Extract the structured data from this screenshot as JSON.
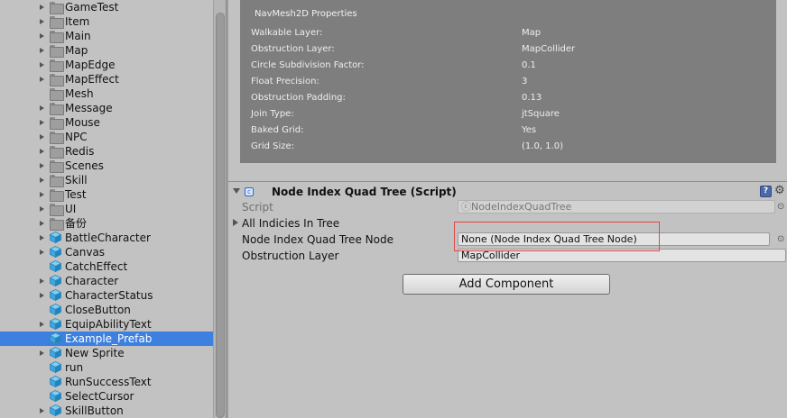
{
  "tree": {
    "items": [
      {
        "label": "GameTest",
        "icon": "folder-icon",
        "arrow": true
      },
      {
        "label": "Item",
        "icon": "folder-icon",
        "arrow": true
      },
      {
        "label": "Main",
        "icon": "folder-icon",
        "arrow": true
      },
      {
        "label": "Map",
        "icon": "folder-icon",
        "arrow": true
      },
      {
        "label": "MapEdge",
        "icon": "folder-icon",
        "arrow": true
      },
      {
        "label": "MapEffect",
        "icon": "folder-icon",
        "arrow": true
      },
      {
        "label": "Mesh",
        "icon": "folder-icon",
        "arrow": false
      },
      {
        "label": "Message",
        "icon": "folder-icon",
        "arrow": true
      },
      {
        "label": "Mouse",
        "icon": "folder-icon",
        "arrow": true
      },
      {
        "label": "NPC",
        "icon": "folder-icon",
        "arrow": true
      },
      {
        "label": "Redis",
        "icon": "folder-icon",
        "arrow": true
      },
      {
        "label": "Scenes",
        "icon": "folder-icon",
        "arrow": true
      },
      {
        "label": "Skill",
        "icon": "folder-icon",
        "arrow": true
      },
      {
        "label": "Test",
        "icon": "folder-icon",
        "arrow": true
      },
      {
        "label": "UI",
        "icon": "folder-icon",
        "arrow": true
      },
      {
        "label": "备份",
        "icon": "folder-icon",
        "arrow": true
      },
      {
        "label": "BattleCharacter",
        "icon": "prefab-icon",
        "arrow": true
      },
      {
        "label": "Canvas",
        "icon": "prefab-icon",
        "arrow": true
      },
      {
        "label": "CatchEffect",
        "icon": "prefab-icon",
        "arrow": false
      },
      {
        "label": "Character",
        "icon": "prefab-icon",
        "arrow": true
      },
      {
        "label": "CharacterStatus",
        "icon": "prefab-icon",
        "arrow": true
      },
      {
        "label": "CloseButton",
        "icon": "prefab-icon",
        "arrow": false
      },
      {
        "label": "EquipAbilityText",
        "icon": "prefab-icon",
        "arrow": true
      },
      {
        "label": "Example_Prefab",
        "icon": "prefab-icon",
        "arrow": false,
        "selected": true
      },
      {
        "label": "New Sprite",
        "icon": "prefab-icon",
        "arrow": true
      },
      {
        "label": "run",
        "icon": "prefab-icon",
        "arrow": false
      },
      {
        "label": "RunSuccessText",
        "icon": "prefab-icon",
        "arrow": false
      },
      {
        "label": "SelectCursor",
        "icon": "prefab-icon",
        "arrow": false
      },
      {
        "label": "SkillButton",
        "icon": "prefab-icon",
        "arrow": true
      }
    ]
  },
  "navmesh": {
    "title": "NavMesh2D Properties",
    "props": [
      {
        "key": "Walkable Layer:",
        "value": "Map"
      },
      {
        "key": "Obstruction Layer:",
        "value": "MapCollider"
      },
      {
        "key": "Circle Subdivision Factor:",
        "value": "0.1"
      },
      {
        "key": "Float Precision:",
        "value": "3"
      },
      {
        "key": "Obstruction Padding:",
        "value": "0.13"
      },
      {
        "key": "Join Type:",
        "value": "jtSquare"
      },
      {
        "key": "Baked Grid:",
        "value": "Yes"
      },
      {
        "key": "Grid Size:",
        "value": "(1.0, 1.0)"
      }
    ]
  },
  "component": {
    "title": "Node Index Quad Tree (Script)",
    "script_label": "Script",
    "script_value": "NodeIndexQuadTree",
    "all_indicies_label": "All Indicies In Tree",
    "node_label": "Node Index Quad Tree Node",
    "node_value": "None (Node Index Quad Tree Node)",
    "obstruction_label": "Obstruction Layer",
    "obstruction_value": "MapCollider"
  },
  "add_component_label": "Add Component",
  "colors": {
    "selection": "#3d80df",
    "highlight_box": "#e04848",
    "panel_bg": "#c2c2c2",
    "navmesh_bg": "#7e7e7e"
  }
}
